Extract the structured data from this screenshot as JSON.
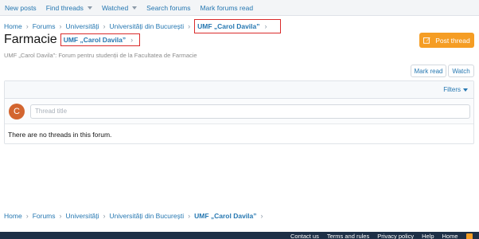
{
  "subnav": {
    "items": [
      {
        "label": "New posts",
        "has_caret": false
      },
      {
        "label": "Find threads",
        "has_caret": true
      },
      {
        "label": "Watched",
        "has_caret": true
      },
      {
        "label": "Search forums",
        "has_caret": false
      },
      {
        "label": "Mark forums read",
        "has_caret": false
      }
    ]
  },
  "breadcrumb": {
    "items": [
      "Home",
      "Forums",
      "Universități",
      "Universități din București"
    ],
    "current": "UMF „Carol Davila”"
  },
  "forum": {
    "title": "Farmacie",
    "parent_link": "UMF „Carol Davila”",
    "description": "UMF „Carol Davila”: Forum pentru studenții de la Facultatea de Farmacie"
  },
  "actions": {
    "post_thread": "Post thread",
    "mark_read": "Mark read",
    "watch": "Watch"
  },
  "list": {
    "filters": "Filters",
    "avatar_letter": "C",
    "thread_placeholder": "Thread title",
    "empty_message": "There are no threads in this forum."
  },
  "bottom_breadcrumb": {
    "items": [
      "Home",
      "Forums",
      "Universități",
      "Universități din București"
    ],
    "current": "UMF „Carol Davila”"
  },
  "footer": {
    "links": [
      "Contact us",
      "Terms and rules",
      "Privacy policy",
      "Help",
      "Home"
    ]
  },
  "colors": {
    "link": "#2577b1",
    "accent": "#f59d24",
    "avatar": "#d3652f",
    "footer": "#1d2f46",
    "highlight_box": "#d92b2b"
  }
}
